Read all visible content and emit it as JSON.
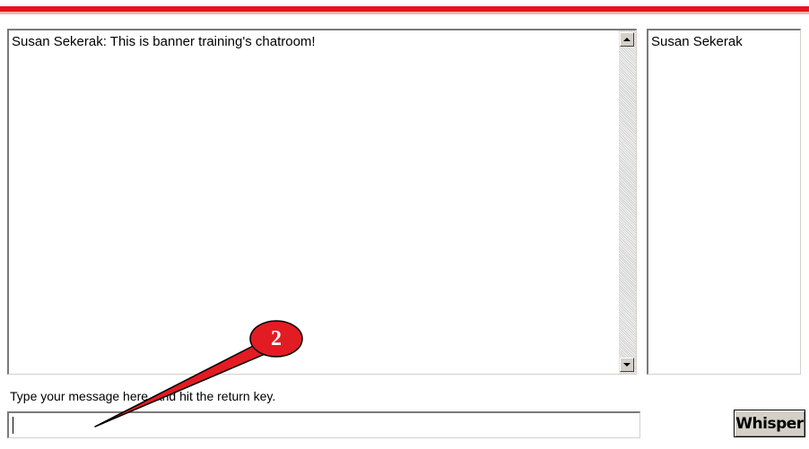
{
  "chat": {
    "messages": [
      {
        "text": "Susan Sekerak: This is banner training's chatroom!"
      }
    ]
  },
  "users": {
    "items": [
      {
        "name": "Susan Sekerak"
      }
    ]
  },
  "composer": {
    "instructions": "Type your message here, and hit the return key.",
    "value": "",
    "whisper_label": "Whisper"
  },
  "annotation": {
    "step_number": "2"
  },
  "colors": {
    "rule": "#e8141b",
    "callout_fill": "#e31b23",
    "callout_outline": "#000000"
  },
  "icons": {
    "scroll_up": "scroll-up-arrow-icon",
    "scroll_down": "scroll-down-arrow-icon"
  }
}
